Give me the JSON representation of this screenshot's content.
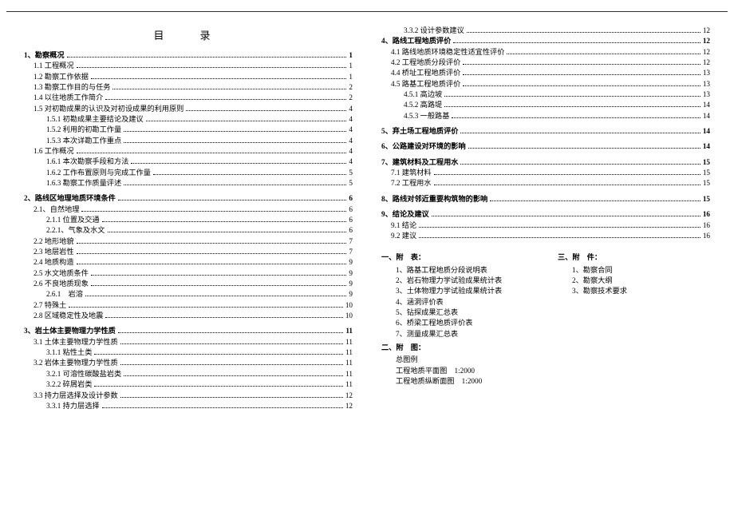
{
  "title": "目　录",
  "left": [
    {
      "t": "1、勘察概况",
      "p": "1",
      "cls": "bold ind0"
    },
    {
      "t": "1.1 工程概况",
      "p": "1",
      "cls": "ind1"
    },
    {
      "t": "1.2 勘察工作依据",
      "p": "1",
      "cls": "ind1"
    },
    {
      "t": "1.3 勘察工作目的与任务",
      "p": "2",
      "cls": "ind1"
    },
    {
      "t": "1.4 以往地质工作简介",
      "p": "2",
      "cls": "ind1"
    },
    {
      "t": "1.5 对初勘成果的认识及对初设成果的利用原则",
      "p": "4",
      "cls": "ind1"
    },
    {
      "t": "1.5.1 初勘成果主要结论及建议",
      "p": "4",
      "cls": "ind2"
    },
    {
      "t": "1.5.2 利用的初勘工作量",
      "p": "4",
      "cls": "ind2"
    },
    {
      "t": "1.5.3 本次详勘工作重点",
      "p": "4",
      "cls": "ind2"
    },
    {
      "t": "1.6 工作概况",
      "p": "4",
      "cls": "ind1"
    },
    {
      "t": "1.6.1 本次勘察手段和方法",
      "p": "4",
      "cls": "ind2"
    },
    {
      "t": "1.6.2 工作布置原则与完成工作量",
      "p": "5",
      "cls": "ind2"
    },
    {
      "t": "1.6.3 勘察工作质量评述",
      "p": "5",
      "cls": "ind2"
    },
    {
      "spacer": true
    },
    {
      "t": "2、路线区地理地质环境条件",
      "p": "6",
      "cls": "bold ind0"
    },
    {
      "t": "2.1、自然地理",
      "p": "6",
      "cls": "ind1"
    },
    {
      "t": "2.1.1 位置及交通",
      "p": "6",
      "cls": "ind2"
    },
    {
      "t": "2.2.1、气象及水文",
      "p": "6",
      "cls": "ind2"
    },
    {
      "t": "2.2 地形地貌",
      "p": "7",
      "cls": "ind1"
    },
    {
      "t": "2.3 地层岩性",
      "p": "7",
      "cls": "ind1"
    },
    {
      "t": "2.4 地质构造",
      "p": "9",
      "cls": "ind1"
    },
    {
      "t": "2.5 水文地质条件",
      "p": "9",
      "cls": "ind1"
    },
    {
      "t": "2.6 不良地质现象",
      "p": "9",
      "cls": "ind1"
    },
    {
      "t": "2.6.1　岩溶",
      "p": "9",
      "cls": "ind2"
    },
    {
      "t": "2.7 特殊土",
      "p": "10",
      "cls": "ind1"
    },
    {
      "t": "2.8 区域稳定性及地震",
      "p": "10",
      "cls": "ind1"
    },
    {
      "spacer": true
    },
    {
      "t": "3、岩土体主要物理力学性质",
      "p": "11",
      "cls": "bold ind0"
    },
    {
      "t": "3.1 土体主要物理力学性质",
      "p": "11",
      "cls": "ind1"
    },
    {
      "t": "3.1.1 粘性土类",
      "p": "11",
      "cls": "ind2"
    },
    {
      "t": "3.2 岩体主要物理力学性质",
      "p": "11",
      "cls": "ind1"
    },
    {
      "t": "3.2.1 可溶性碳酸盐岩类",
      "p": "11",
      "cls": "ind2"
    },
    {
      "t": "3.2.2 碎屑岩类",
      "p": "11",
      "cls": "ind2"
    },
    {
      "t": "3.3 持力层选择及设计参数",
      "p": "12",
      "cls": "ind1"
    },
    {
      "t": "3.3.1 持力层选择",
      "p": "12",
      "cls": "ind2"
    }
  ],
  "right": [
    {
      "t": "3.3.2 设计参数建议",
      "p": "12",
      "cls": "ind2"
    },
    {
      "t": "4、路线工程地质评价",
      "p": "12",
      "cls": "bold ind0"
    },
    {
      "t": "4.1 路线地质环境稳定性适宜性评价",
      "p": "12",
      "cls": "ind1"
    },
    {
      "t": "4.2 工程地质分段评价",
      "p": "12",
      "cls": "ind1"
    },
    {
      "t": "4.4 桥址工程地质评价",
      "p": "13",
      "cls": "ind1"
    },
    {
      "t": "4.5 路基工程地质评价",
      "p": "13",
      "cls": "ind1"
    },
    {
      "t": "4.5.1 高边坡",
      "p": "13",
      "cls": "ind2"
    },
    {
      "t": "4.5.2 高路堤",
      "p": "14",
      "cls": "ind2"
    },
    {
      "t": "4.5.3 一般路基",
      "p": "14",
      "cls": "ind2"
    },
    {
      "spacer": true
    },
    {
      "t": "5、弃土场工程地质评价",
      "p": "14",
      "cls": "bold ind0"
    },
    {
      "spacer": true
    },
    {
      "t": "6、公路建设对环境的影响",
      "p": "14",
      "cls": "bold ind0"
    },
    {
      "spacer": true
    },
    {
      "t": "7、建筑材料及工程用水",
      "p": "15",
      "cls": "bold ind0"
    },
    {
      "t": "7.1 建筑材料",
      "p": "15",
      "cls": "ind1"
    },
    {
      "t": "7.2 工程用水",
      "p": "15",
      "cls": "ind1"
    },
    {
      "spacer": true
    },
    {
      "t": "8、路线对邻近重要构筑物的影响",
      "p": "15",
      "cls": "bold ind0"
    },
    {
      "spacer": true
    },
    {
      "t": "9、结论及建议",
      "p": "16",
      "cls": "bold ind0"
    },
    {
      "t": "9.1 结论",
      "p": "16",
      "cls": "ind1"
    },
    {
      "t": "9.2 建议",
      "p": "16",
      "cls": "ind1"
    }
  ],
  "apx": {
    "a": {
      "title": "一、附　表：",
      "items": [
        "1、路基工程地质分段说明表",
        "2、岩石物理力学试验成果统计表",
        "3、土体物理力学试验成果统计表",
        "4、涵洞评价表",
        "5、钻探成果汇总表",
        "6、桥梁工程地质评价表",
        "7、测量成果汇总表"
      ]
    },
    "b": {
      "title": "三、附　件：",
      "items": [
        "1、勘察合同",
        "2、勘察大纲",
        "3、勘察技术要求"
      ]
    },
    "c": {
      "title": "二、附　图：",
      "items": [
        "总图例",
        "工程地质平面图　1:2000",
        "工程地质纵断面图　1:2000"
      ]
    }
  }
}
